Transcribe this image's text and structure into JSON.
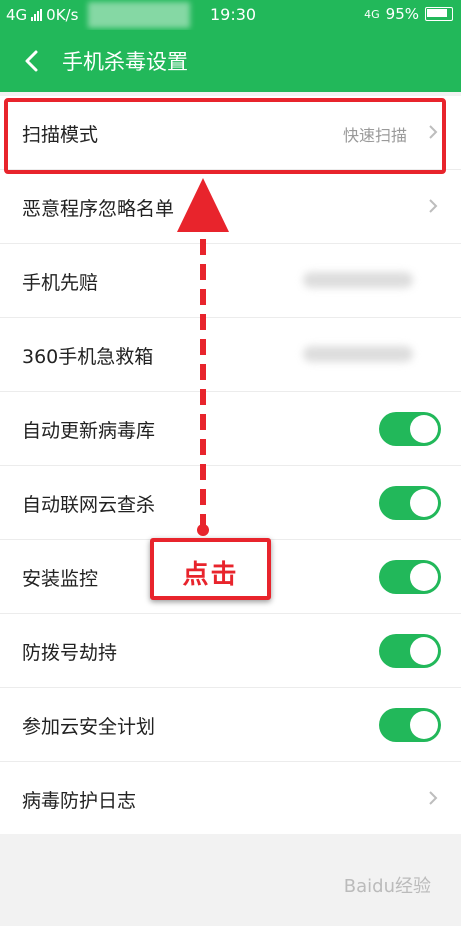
{
  "status_bar": {
    "network": "4G",
    "speed": "0K/s",
    "time": "19:30",
    "network_right": "4G",
    "battery": "95%"
  },
  "header": {
    "title": "手机杀毒设置"
  },
  "settings": [
    {
      "label": "扫描模式",
      "value": "快速扫描",
      "control": "chevron"
    },
    {
      "label": "恶意程序忽略名单",
      "value": "",
      "control": "chevron"
    },
    {
      "label": "手机先赔",
      "value": "",
      "control": "blurred"
    },
    {
      "label": "360手机急救箱",
      "value": "",
      "control": "blurred"
    },
    {
      "label": "自动更新病毒库",
      "value": "",
      "control": "toggle",
      "on": true
    },
    {
      "label": "自动联网云查杀",
      "value": "",
      "control": "toggle",
      "on": true
    },
    {
      "label": "安装监控",
      "value": "",
      "control": "toggle",
      "on": true
    },
    {
      "label": "防拨号劫持",
      "value": "",
      "control": "toggle",
      "on": true
    },
    {
      "label": "参加云安全计划",
      "value": "",
      "control": "toggle",
      "on": true
    },
    {
      "label": "病毒防护日志",
      "value": "",
      "control": "chevron"
    }
  ],
  "annotation": {
    "text": "点击"
  },
  "colors": {
    "brand_green": "#22b85a",
    "annotation_red": "#e8242c"
  },
  "watermark": "Baidu经验"
}
